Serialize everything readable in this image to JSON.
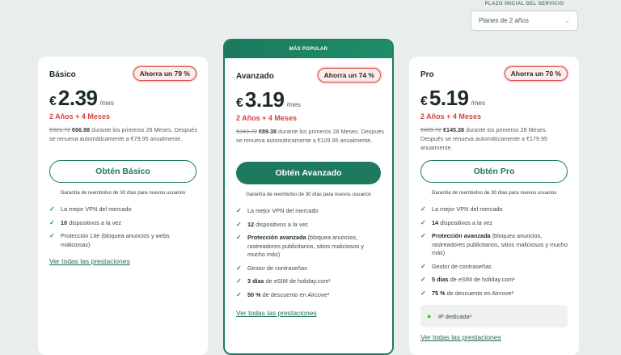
{
  "term": {
    "label": "PLAZO INICIAL DEL SERVICIO",
    "selected": "Planes de 2 años",
    "chevron_icon": "chevron-down-icon"
  },
  "colors": {
    "brand": "#1e7a5f",
    "discount": "#d0443f",
    "check": "#1e8a66"
  },
  "plans": {
    "basic": {
      "name": "Básico",
      "save": "Ahorra un 79 %",
      "currency": "€",
      "price": "2.39",
      "per": "/mes",
      "bonus": "2 Años + 4 Meses",
      "old": "€321.72",
      "new": "€66.98",
      "terms1": " durante los primeros 28 Meses.",
      "terms2": "Después se renueva automáticamente a €79.95 anualmente.",
      "cta": "Obtén Básico",
      "guarantee": "Garantía de reembolso de 30 días para nuevos usuarios",
      "features": [
        {
          "b": "",
          "t": "La mejor VPN del mercado"
        },
        {
          "b": "10",
          "t": " dispositivos a la vez"
        },
        {
          "b": "",
          "t": "Protección Lite (bloquea anuncios y webs maliciosas)"
        }
      ],
      "see_all": "Ver todas las prestaciones"
    },
    "adv": {
      "popular": "MÁS POPULAR",
      "name": "Avanzado",
      "save": "Ahorra un 74 %",
      "currency": "€",
      "price": "3.19",
      "per": "/mes",
      "bonus": "2 Años + 4 Meses",
      "old": "€349.72",
      "new": "€89.38",
      "terms1": " durante los primeros 28 Meses.",
      "terms2": "Después se renueva automáticamente a €109.95 anualmente.",
      "cta": "Obtén Avanzado",
      "guarantee": "Garantía de reembolso de 30 días para nuevos usuarios",
      "features": [
        {
          "b": "",
          "t": "La mejor VPN del mercado"
        },
        {
          "b": "12",
          "t": " dispositivos a la vez"
        },
        {
          "b": "Protección avanzada",
          "t": " (bloquea anuncios, rastreadores publicitarios, sitios maliciosos y mucho más)"
        },
        {
          "b": "",
          "t": "Gestor de contraseñas"
        },
        {
          "b": "3 días",
          "t": " de eSIM de holiday.com¹"
        },
        {
          "b": "50 %",
          "t": " de descuento en Aircove²"
        }
      ],
      "see_all": "Ver todas las prestaciones"
    },
    "pro": {
      "name": "Pro",
      "save": "Ahorra un 70 %",
      "currency": "€",
      "price": "5.19",
      "per": "/mes",
      "bonus": "2 Años + 4 Meses",
      "old": "€489.72",
      "new": "€145.38",
      "terms1": " durante los primeros 28 Meses.",
      "terms2": "Después se renueva automáticamente a €179.95 anualmente.",
      "cta": "Obtén Pro",
      "guarantee": "Garantía de reembolso de 30 días para nuevos usuarios",
      "features": [
        {
          "b": "",
          "t": "La mejor VPN del mercado"
        },
        {
          "b": "14",
          "t": " dispositivos a la vez"
        },
        {
          "b": "Protección avanzada",
          "t": " (bloquea anuncios, rastreadores publicitarios, sitios maliciosos y mucho más)"
        },
        {
          "b": "",
          "t": "Gestor de contraseñas"
        },
        {
          "b": "5 días",
          "t": " de eSIM de holiday.com¹"
        },
        {
          "b": "75 %",
          "t": " de descuento en Aircove²"
        }
      ],
      "ip": "IP dedicada³",
      "see_all": "Ver todas las prestaciones"
    }
  }
}
